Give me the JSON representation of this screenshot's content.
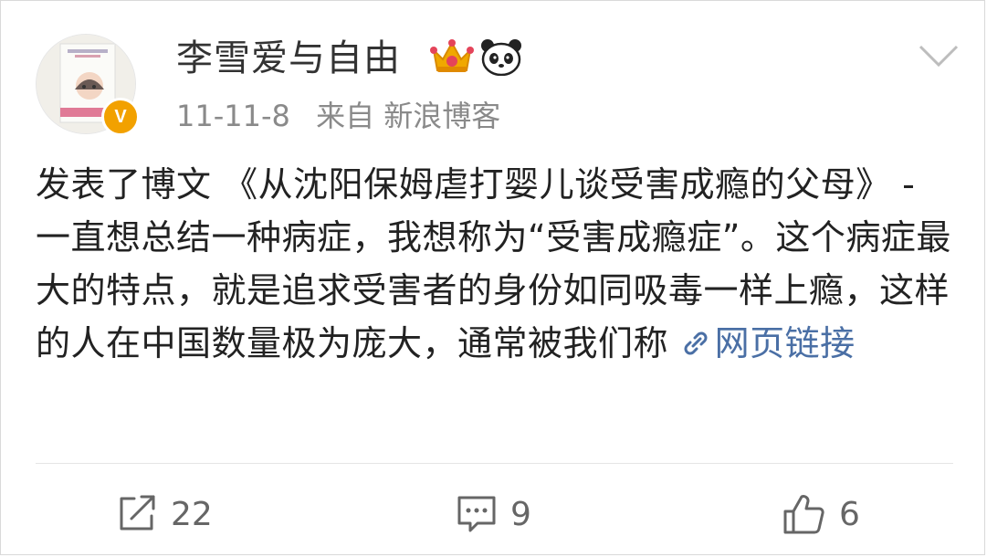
{
  "post": {
    "username": "李雪爱与自由",
    "timestamp": "11-11-8",
    "source_label": "来自",
    "source": "新浪博客",
    "body_text": "发表了博文 《从沈阳保姆虐打婴儿谈受害成瘾的父母》 - 一直想总结一种病症，我想称为“受害成瘾症”。这个病症最大的特点，就是追求受害者的身份如同吸毒一样上瘾，这样的人在中国数量极为庞大，通常被我们称",
    "link_label": "网页链接"
  },
  "badges": {
    "verified": "V",
    "icons": [
      "crown-icon",
      "panda-icon"
    ]
  },
  "actions": {
    "repost_count": "22",
    "comment_count": "9",
    "like_count": "6"
  },
  "colors": {
    "link": "#4a6fa5",
    "verified_badge": "#f2a100",
    "meta_text": "#8a8a8a"
  }
}
